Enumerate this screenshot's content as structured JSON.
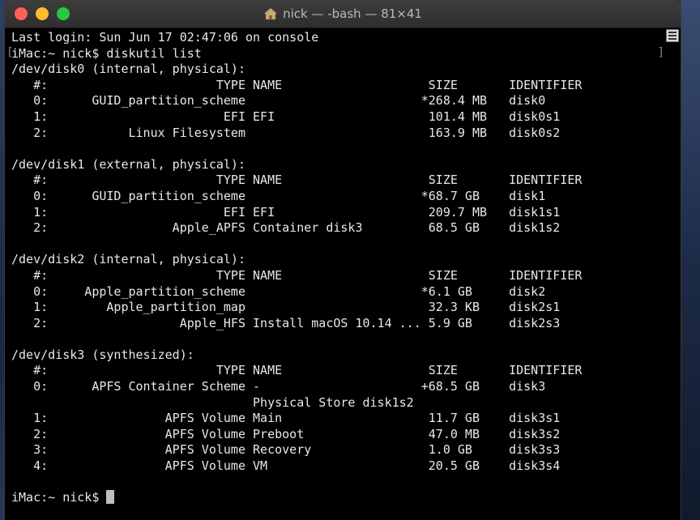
{
  "window": {
    "title": "nick — -bash — 81×41",
    "colors": {
      "close": "#fe5f57",
      "minimize": "#febc2e",
      "maximize": "#28c840",
      "terminal_bg": "#000000",
      "terminal_fg": "#e8e8e8"
    }
  },
  "terminal": {
    "lines": [
      "Last login: Sun Jun 17 02:47:06 on console",
      "iMac:~ nick$ diskutil list",
      "/dev/disk0 (internal, physical):",
      "   #:                       TYPE NAME                    SIZE       IDENTIFIER",
      "   0:      GUID_partition_scheme                        *268.4 MB   disk0",
      "   1:                        EFI EFI                     101.4 MB   disk0s1",
      "   2:           Linux Filesystem                         163.9 MB   disk0s2",
      "",
      "/dev/disk1 (external, physical):",
      "   #:                       TYPE NAME                    SIZE       IDENTIFIER",
      "   0:      GUID_partition_scheme                        *68.7 GB    disk1",
      "   1:                        EFI EFI                     209.7 MB   disk1s1",
      "   2:                 Apple_APFS Container disk3         68.5 GB    disk1s2",
      "",
      "/dev/disk2 (internal, physical):",
      "   #:                       TYPE NAME                    SIZE       IDENTIFIER",
      "   0:     Apple_partition_scheme                        *6.1 GB     disk2",
      "   1:        Apple_partition_map                         32.3 KB    disk2s1",
      "   2:                  Apple_HFS Install macOS 10.14 ... 5.9 GB     disk2s3",
      "",
      "/dev/disk3 (synthesized):",
      "   #:                       TYPE NAME                    SIZE       IDENTIFIER",
      "   0:      APFS Container Scheme -                      +68.5 GB    disk3",
      "                                 Physical Store disk1s2",
      "   1:                APFS Volume Main                    11.7 GB    disk3s1",
      "   2:                APFS Volume Preboot                 47.0 MB    disk3s2",
      "   3:                APFS Volume Recovery                1.0 GB     disk3s3",
      "   4:                APFS Volume VM                      20.5 GB    disk3s4",
      ""
    ],
    "prompt": "iMac:~ nick$ ",
    "icons": {
      "title": "home-icon",
      "scroll": "list-icon"
    }
  }
}
